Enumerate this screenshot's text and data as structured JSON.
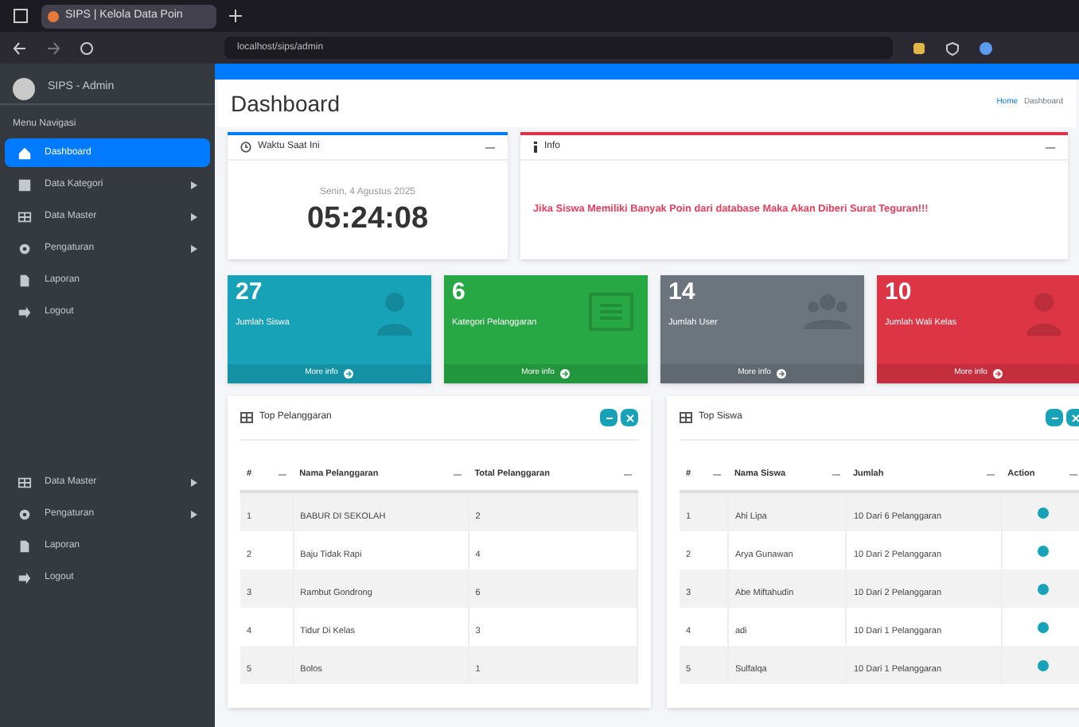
{
  "browser": {
    "tab_title": "SIPS | Kelola Data Poin",
    "url": "localhost/sips/admin"
  },
  "sidebar": {
    "user": "SIPS - Admin",
    "header": "Menu Navigasi",
    "items": [
      {
        "kind": "link",
        "label": "Dashboard",
        "selected": true,
        "has_children": false
      },
      {
        "kind": "link",
        "label": "Data Kategori",
        "selected": false,
        "has_children": true
      },
      {
        "kind": "link",
        "label": "Data Master",
        "selected": false,
        "has_children": true
      },
      {
        "kind": "link",
        "label": "Pengaturan",
        "selected": false,
        "has_children": true
      },
      {
        "kind": "link",
        "label": "Laporan",
        "selected": false,
        "has_children": false
      },
      {
        "kind": "link",
        "label": "Logout",
        "selected": false,
        "has_children": false
      },
      {
        "kind": "gap"
      },
      {
        "kind": "link",
        "label": "Data Master",
        "selected": false,
        "has_children": true
      },
      {
        "kind": "link",
        "label": "Pengaturan",
        "selected": false,
        "has_children": true
      },
      {
        "kind": "link",
        "label": "Laporan",
        "selected": false,
        "has_children": false
      },
      {
        "kind": "link",
        "label": "Logout",
        "selected": false,
        "has_children": false
      }
    ]
  },
  "page": {
    "title": "Dashboard",
    "breadcrumb": [
      "Home",
      "Dashboard"
    ]
  },
  "clock_card": {
    "title": "Waktu Saat Ini",
    "date": "Senin, 4 Agustus 2025",
    "time": "05:24:08"
  },
  "info_card": {
    "title": "Info",
    "message": "Jika Siswa Memiliki Banyak Poin dari database Maka Akan Diberi Surat Teguran!!!"
  },
  "stat_boxes": [
    {
      "value": "27",
      "label": "Jumlah Siswa",
      "link": "More info",
      "color": "#17a2b8"
    },
    {
      "value": "6",
      "label": "Kategori Pelanggaran",
      "link": "More info",
      "color": "#28a745"
    },
    {
      "value": "14",
      "label": "Jumlah User",
      "link": "More info",
      "color": "#6c757d"
    },
    {
      "value": "10",
      "label": "Jumlah Wali Kelas",
      "link": "More info",
      "color": "#dc3545"
    }
  ],
  "tables": [
    {
      "title": "Top Pelanggaran",
      "columns": [
        "#",
        "Nama Pelanggaran",
        "Total Pelanggaran"
      ],
      "rows": [
        [
          "1",
          "BABUR DI SEKOLAH",
          "2"
        ],
        [
          "2",
          "Baju Tidak Rapi",
          "4"
        ],
        [
          "3",
          "Rambut Gondrong",
          "6"
        ],
        [
          "4",
          "Tidur Di Kelas",
          "3"
        ],
        [
          "5",
          "Bolos",
          "1"
        ]
      ]
    },
    {
      "title": "Top Siswa",
      "columns": [
        "#",
        "Nama Siswa",
        "Jumlah",
        "Action"
      ],
      "rows": [
        [
          "1",
          "Ahi Lipa",
          "10 Dari 6 Pelanggaran"
        ],
        [
          "2",
          "Arya Gunawan",
          "10 Dari 2 Pelanggaran"
        ],
        [
          "3",
          "Abe Miftahudin",
          "10 Dari 2 Pelanggaran"
        ],
        [
          "4",
          "adi",
          "10 Dari 1 Pelanggaran"
        ],
        [
          "5",
          "Sulfalqa",
          "10 Dari 1 Pelanggaran"
        ]
      ]
    }
  ]
}
